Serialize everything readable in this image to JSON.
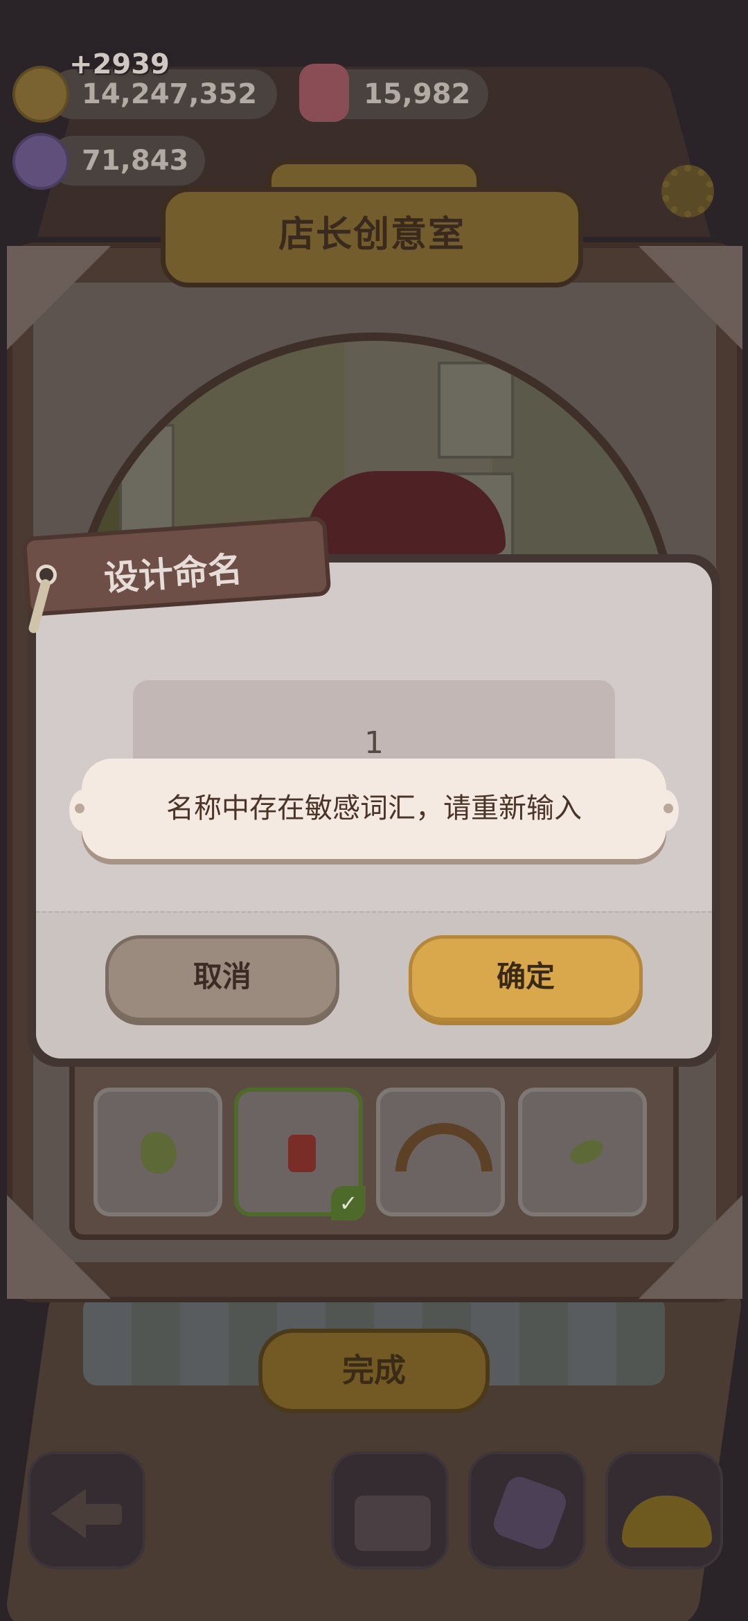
{
  "currencies": {
    "gain_popup": "+2939",
    "coins": "14,247,352",
    "gems": "15,982",
    "candy": "71,843"
  },
  "room": {
    "title": "店长创意室",
    "done_label": "完成"
  },
  "dialog": {
    "tag_title": "设计命名",
    "name_input_value": "1",
    "cancel_label": "取消",
    "confirm_label": "确定"
  },
  "toast": {
    "message": "名称中存在敏感词汇，请重新输入"
  },
  "colors": {
    "dialog_bg": "#d2cbc9",
    "confirm_button": "#d9a84c",
    "cancel_button": "#9b8b7e",
    "toast_bg": "#f4eae1"
  },
  "icons": {
    "coin": "cookie-coin-icon",
    "gem": "pink-cake-gem-icon",
    "candy": "purple-candy-icon",
    "settings": "gear-icon",
    "back": "back-arrow-icon"
  }
}
